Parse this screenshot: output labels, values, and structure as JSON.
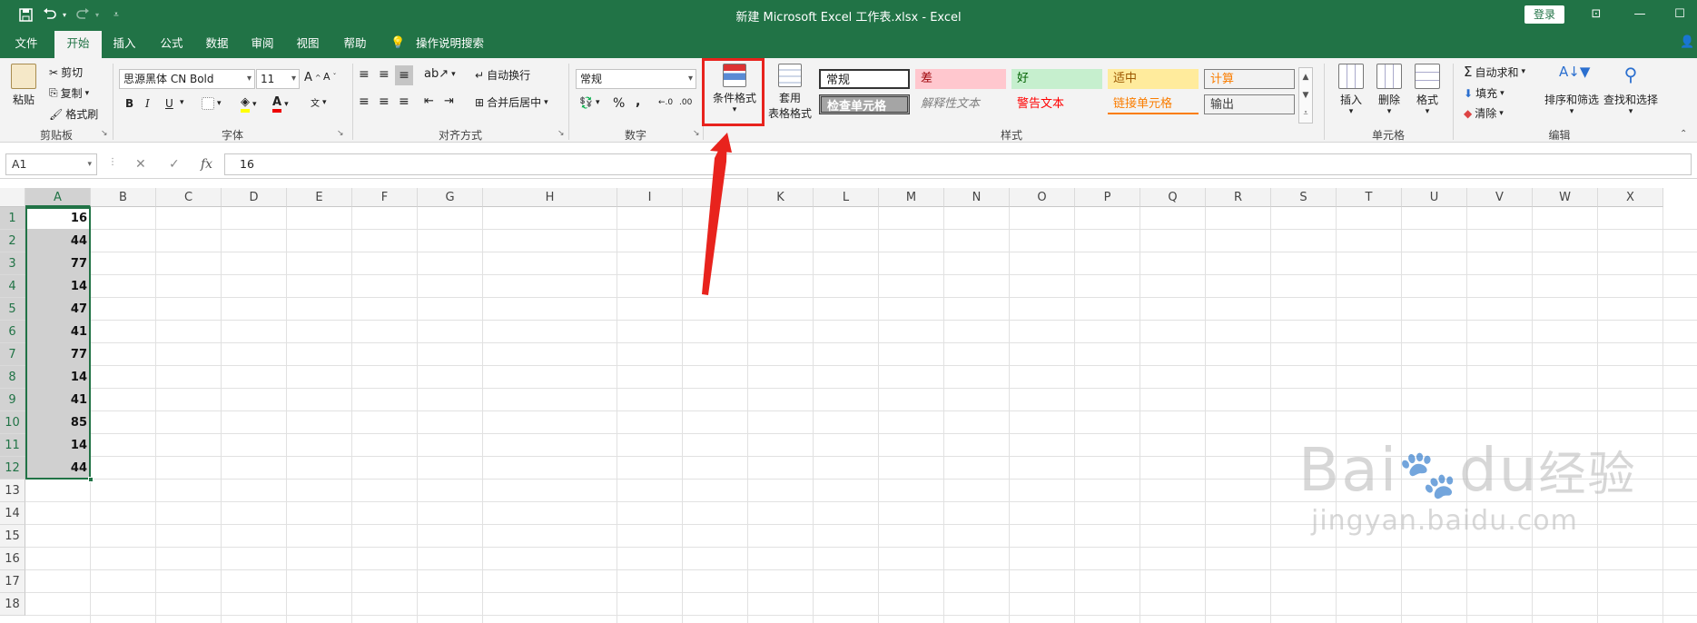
{
  "titlebar": {
    "title": "新建 Microsoft Excel 工作表.xlsx  -  Excel",
    "login_label": "登录",
    "save_icon": "save-icon",
    "undo_icon": "undo-icon",
    "redo_icon": "redo-icon",
    "customize_icon": "customize-qat-icon"
  },
  "tabs": [
    "文件",
    "开始",
    "插入",
    "公式",
    "数据",
    "审阅",
    "视图",
    "帮助"
  ],
  "active_tab": "开始",
  "tellme": "操作说明搜索",
  "clipboard": {
    "paste": "粘贴",
    "cut": "剪切",
    "copy": "复制",
    "format_painter": "格式刷",
    "label": "剪贴板"
  },
  "font": {
    "name": "思源黑体 CN Bold",
    "size": "11",
    "bold": "B",
    "italic": "I",
    "underline": "U",
    "label": "字体"
  },
  "alignment": {
    "wrap": "自动换行",
    "merge": "合并后居中",
    "label": "对齐方式"
  },
  "number": {
    "format": "常规",
    "percent": "%",
    "comma": ",",
    "label": "数字"
  },
  "styles": {
    "conditional": "条件格式",
    "table_line1": "套用",
    "table_line2": "表格格式",
    "cells": [
      {
        "text": "常规",
        "bg": "#ffffff",
        "color": "#222222"
      },
      {
        "text": "差",
        "bg": "#ffc7ce",
        "color": "#9c0006"
      },
      {
        "text": "好",
        "bg": "#c6efce",
        "color": "#006100"
      },
      {
        "text": "适中",
        "bg": "#ffeb9c",
        "color": "#9c5700"
      },
      {
        "text": "计算",
        "bg": "#f2f2f2",
        "color": "#fa7d00"
      },
      {
        "text": "检查单元格",
        "bg": "#a5a5a5",
        "color": "#ffffff"
      },
      {
        "text": "解释性文本",
        "bg": "#f3f3f3",
        "color": "#7f7f7f"
      },
      {
        "text": "警告文本",
        "bg": "#f3f3f3",
        "color": "#ff0000"
      },
      {
        "text": "链接单元格",
        "bg": "#f3f3f3",
        "color": "#fa7d00"
      },
      {
        "text": "输出",
        "bg": "#f2f2f2",
        "color": "#3f3f3f"
      }
    ],
    "label": "样式"
  },
  "cells_group": {
    "insert": "插入",
    "delete": "删除",
    "format": "格式",
    "label": "单元格"
  },
  "editing": {
    "autosum": "自动求和",
    "fill": "填充",
    "clear": "清除",
    "sort": "排序和筛选",
    "find": "查找和选择",
    "label": "编辑"
  },
  "formula_bar": {
    "name_box": "A1",
    "content": "16",
    "fx": "fx"
  },
  "columns": [
    "A",
    "B",
    "C",
    "D",
    "E",
    "F",
    "G",
    "H",
    "I",
    "J",
    "K",
    "L",
    "M",
    "N",
    "O",
    "P",
    "Q",
    "R",
    "S",
    "T",
    "U",
    "V",
    "W",
    "X"
  ],
  "rows": [
    "1",
    "2",
    "3",
    "4",
    "5",
    "6",
    "7",
    "8",
    "9",
    "10",
    "11",
    "12",
    "13",
    "14",
    "15",
    "16",
    "17",
    "18"
  ],
  "column_a_values": [
    "16",
    "44",
    "77",
    "14",
    "47",
    "41",
    "77",
    "14",
    "41",
    "85",
    "14",
    "44"
  ],
  "watermark": {
    "line1": "Bai",
    "line2": "du",
    "line3": "经验",
    "url": "jingyan.baidu.com"
  }
}
